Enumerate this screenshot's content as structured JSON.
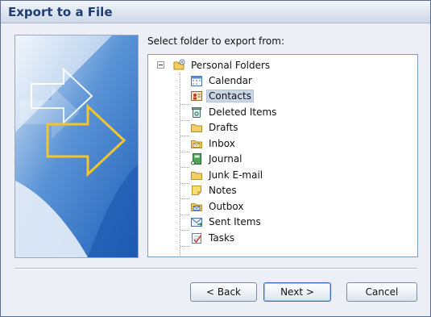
{
  "window": {
    "title": "Export to a File"
  },
  "prompt": "Select folder to export from:",
  "tree": {
    "root": {
      "label": "Personal Folders",
      "icon": "personal-folders-icon",
      "expanded": true
    },
    "items": [
      {
        "label": "Calendar",
        "icon": "calendar-icon"
      },
      {
        "label": "Contacts",
        "icon": "contacts-icon",
        "selected": true
      },
      {
        "label": "Deleted Items",
        "icon": "deleted-items-icon"
      },
      {
        "label": "Drafts",
        "icon": "folder-icon"
      },
      {
        "label": "Inbox",
        "icon": "inbox-icon"
      },
      {
        "label": "Journal",
        "icon": "journal-icon"
      },
      {
        "label": "Junk E-mail",
        "icon": "folder-icon"
      },
      {
        "label": "Notes",
        "icon": "notes-icon"
      },
      {
        "label": "Outbox",
        "icon": "outbox-icon"
      },
      {
        "label": "Sent Items",
        "icon": "sent-items-icon"
      },
      {
        "label": "Tasks",
        "icon": "tasks-icon"
      }
    ]
  },
  "buttons": {
    "back": "< Back",
    "next": "Next >",
    "cancel": "Cancel"
  },
  "colors": {
    "title_text": "#1f3d73",
    "selection": "#c9d6e8",
    "wizard_blue": "#2f6fc4",
    "arrow_yellow": "#f2c430"
  }
}
